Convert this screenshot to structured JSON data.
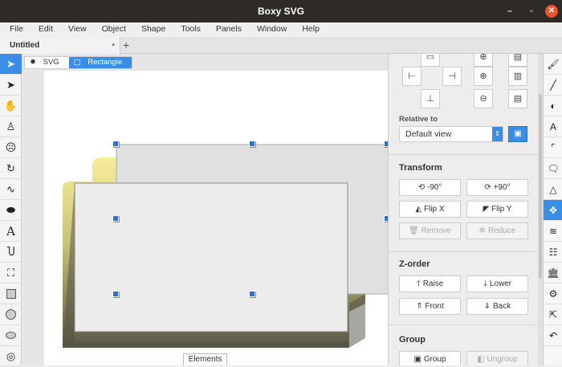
{
  "window": {
    "title": "Boxy SVG",
    "minimize": "–",
    "maximize": "▫",
    "close": "✕"
  },
  "menu": [
    "File",
    "Edit",
    "View",
    "Object",
    "Shape",
    "Tools",
    "Panels",
    "Window",
    "Help"
  ],
  "tabs": [
    {
      "label": "Untitled",
      "modified": "•"
    }
  ],
  "add_tab": "+",
  "breadcrumb": {
    "root": "SVG",
    "current": "Rectangle"
  },
  "elements_button": "Elements",
  "left_tools": [
    "select-arrow",
    "node-arrow",
    "hand",
    "person",
    "faces",
    "spiral",
    "freehand",
    "ellipse-fill",
    "A",
    "crop",
    "dims",
    "rectangle",
    "circle",
    "ellipse",
    "ring"
  ],
  "panel": {
    "relative_to_label": "Relative to",
    "relative_to_value": "Default view",
    "transform": {
      "title": "Transform",
      "rotate_ccw": "-90°",
      "rotate_cw": "+90°",
      "flip_x": "Flip X",
      "flip_y": "Flip Y",
      "remove": "Remove",
      "reduce": "Reduce"
    },
    "zorder": {
      "title": "Z-order",
      "raise": "Raise",
      "lower": "Lower",
      "front": "Front",
      "back": "Back"
    },
    "group": {
      "title": "Group",
      "group": "Group",
      "ungroup": "Ungroup"
    }
  },
  "accent": "#3a8ee6"
}
